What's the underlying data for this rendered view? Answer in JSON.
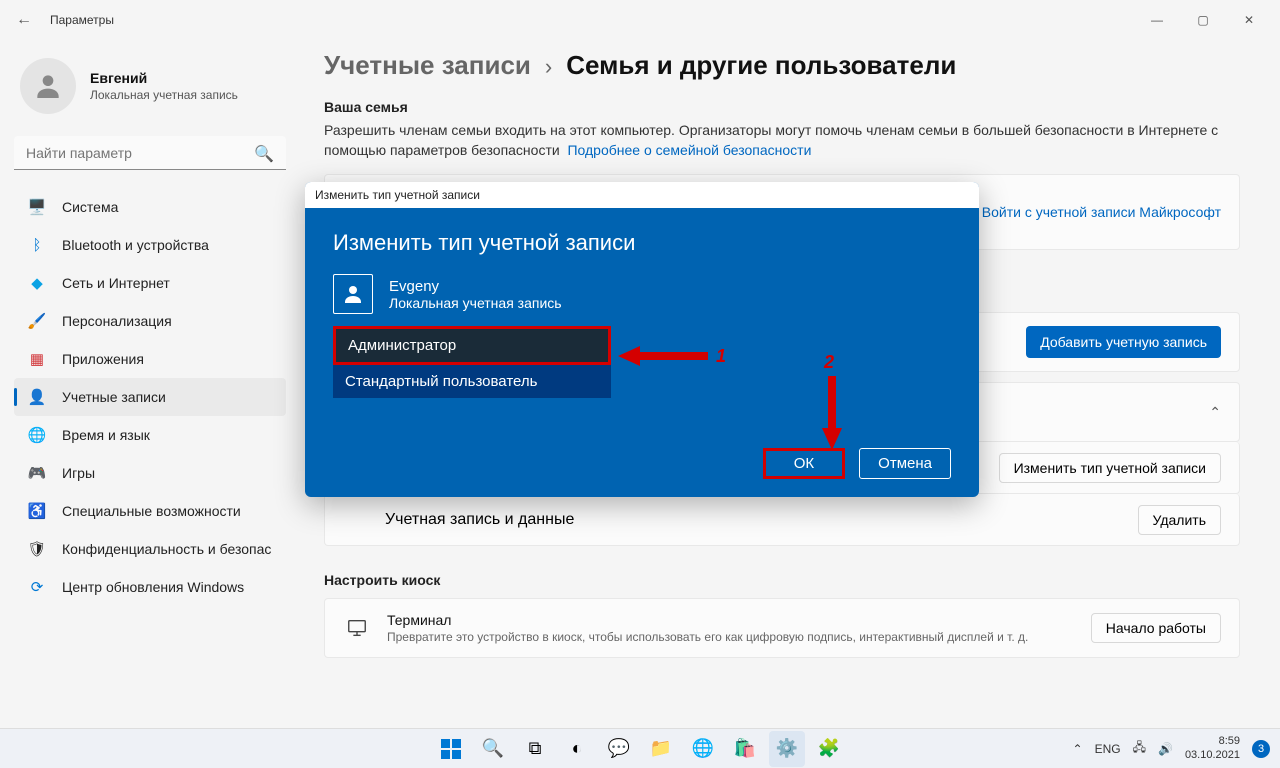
{
  "window": {
    "title": "Параметры"
  },
  "user": {
    "name": "Евгений",
    "subtitle": "Локальная учетная запись"
  },
  "search": {
    "placeholder": "Найти параметр"
  },
  "nav": [
    {
      "icon": "🖥️",
      "label": "Система",
      "color": "#0078d4"
    },
    {
      "icon": "ᛒ",
      "label": "Bluetooth и устройства",
      "color": "#0078d4"
    },
    {
      "icon": "◆",
      "label": "Сеть и Интернет",
      "color": "#0aa2e4"
    },
    {
      "icon": "🖌️",
      "label": "Персонализация",
      "color": "#c06300"
    },
    {
      "icon": "▦",
      "label": "Приложения",
      "color": "#d13438"
    },
    {
      "icon": "👤",
      "label": "Учетные записи",
      "color": "#6b8e23"
    },
    {
      "icon": "🌐",
      "label": "Время и язык",
      "color": "#0078d4"
    },
    {
      "icon": "🎮",
      "label": "Игры",
      "color": "#888"
    },
    {
      "icon": "♿",
      "label": "Специальные возможности",
      "color": "#0078d4"
    },
    {
      "icon": "🛡",
      "label": "Конфиденциальность и безопас",
      "color": "#888"
    },
    {
      "icon": "⟳",
      "label": "Центр обновления Windows",
      "color": "#0078d4"
    }
  ],
  "breadcrumb": {
    "part1": "Учетные записи",
    "part2": "Семья и другие пользователи"
  },
  "family": {
    "title": "Ваша семья",
    "desc": "Разрешить членам семьи входить на этот компьютер. Организаторы могут помочь членам семьи в большей безопасности в Интернете с помощью параметров безопасности",
    "link": "Подробнее о семейной безопасности",
    "ms_signin": "Войти с учетной записи Майкрософт"
  },
  "add_btn": "Добавить учетную запись",
  "change_type_btn": "Изменить тип учетной записи",
  "account_data_label": "Учетная запись и данные",
  "delete_btn": "Удалить",
  "kiosk": {
    "section": "Настроить киоск",
    "title": "Терминал",
    "sub": "Превратите это устройство в киоск, чтобы использовать его как цифровую подпись, интерактивный дисплей и т. д.",
    "btn": "Начало работы"
  },
  "modal": {
    "titlebar": "Изменить тип учетной записи",
    "heading": "Изменить тип учетной записи",
    "user_name": "Evgeny",
    "user_sub": "Локальная учетная запись",
    "opt1": "Администратор",
    "opt2": "Стандартный пользователь",
    "ok": "ОК",
    "cancel": "Отмена"
  },
  "annotations": {
    "n1": "1",
    "n2": "2"
  },
  "taskbar": {
    "lang": "ENG",
    "time": "8:59",
    "date": "03.10.2021",
    "badge": "3"
  }
}
